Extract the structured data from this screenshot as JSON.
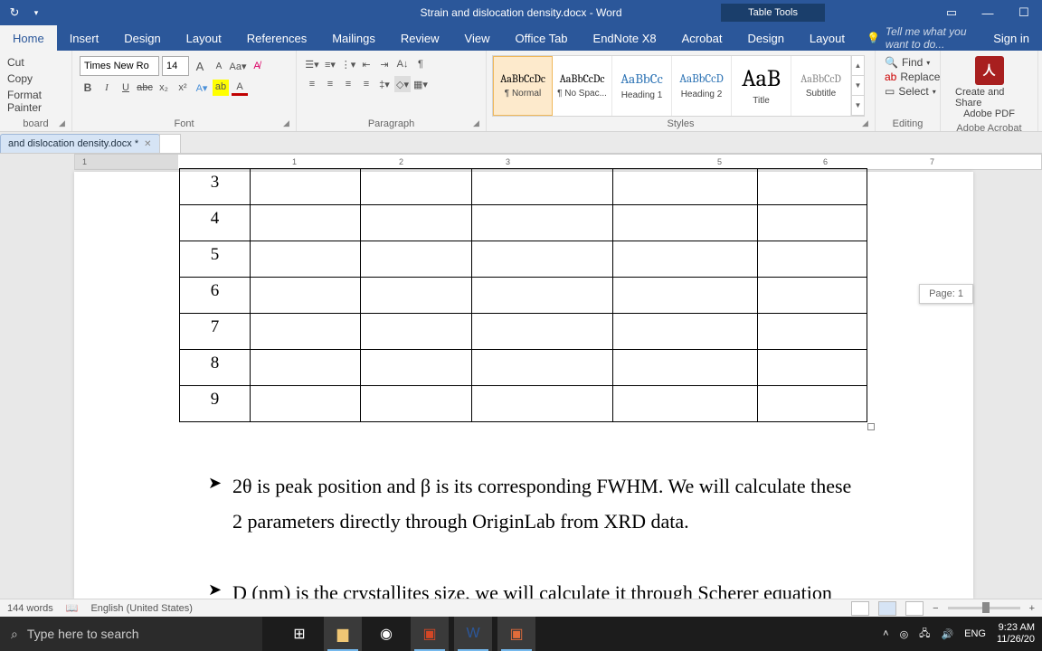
{
  "title_bar": {
    "doc_title": "Strain and dislocation density.docx - Word",
    "table_tools": "Table Tools"
  },
  "ribbon_tabs": {
    "home": "Home",
    "insert": "Insert",
    "design": "Design",
    "layout": "Layout",
    "references": "References",
    "mailings": "Mailings",
    "review": "Review",
    "view": "View",
    "office_tab": "Office Tab",
    "endnote": "EndNote X8",
    "acrobat": "Acrobat",
    "tt_design": "Design",
    "tt_layout": "Layout",
    "tell_me": "Tell me what you want to do...",
    "sign_in": "Sign in"
  },
  "clipboard": {
    "cut": "Cut",
    "copy": "Copy",
    "format_painter": "Format Painter",
    "label": "board"
  },
  "font": {
    "name": "Times New Ro",
    "size": "14",
    "label": "Font"
  },
  "paragraph": {
    "label": "Paragraph"
  },
  "styles": {
    "label": "Styles",
    "items": [
      {
        "preview": "AaBbCcDc",
        "name": "¶ Normal",
        "size": "12px",
        "color": "#000",
        "selected": true
      },
      {
        "preview": "AaBbCcDc",
        "name": "¶ No Spac...",
        "size": "12px",
        "color": "#000"
      },
      {
        "preview": "AaBbCc",
        "name": "Heading 1",
        "size": "15px",
        "color": "#2e74b5"
      },
      {
        "preview": "AaBbCcD",
        "name": "Heading 2",
        "size": "13px",
        "color": "#2e74b5"
      },
      {
        "preview": "AaB",
        "name": "Title",
        "size": "26px",
        "color": "#000"
      },
      {
        "preview": "AaBbCcD",
        "name": "Subtitle",
        "size": "12px",
        "color": "#888"
      }
    ]
  },
  "editing": {
    "find": "Find",
    "replace": "Replace",
    "select": "Select",
    "label": "Editing"
  },
  "acrobat_grp": {
    "line1": "Create and Share",
    "line2": "Adobe PDF",
    "label": "Adobe Acrobat"
  },
  "doc_tab": {
    "name": "and dislocation density.docx *"
  },
  "ruler_marks": [
    "1",
    "1",
    "2",
    "3",
    "5",
    "6",
    "7"
  ],
  "table_rows": [
    "3",
    "4",
    "5",
    "6",
    "7",
    "8",
    "9"
  ],
  "body": {
    "p1": "2θ is peak position and β is its corresponding FWHM. We will calculate these 2 parameters directly through OriginLab from XRD data.",
    "p2": "D (nm) is the crystallites size, we will calculate it through Scherer equation"
  },
  "page_ind": "Page: 1",
  "status": {
    "words": "144 words",
    "lang": "English (United States)"
  },
  "taskbar": {
    "search": "Type here to search",
    "ime": "ENG",
    "time": "9:23 AM",
    "date": "11/26/20"
  }
}
